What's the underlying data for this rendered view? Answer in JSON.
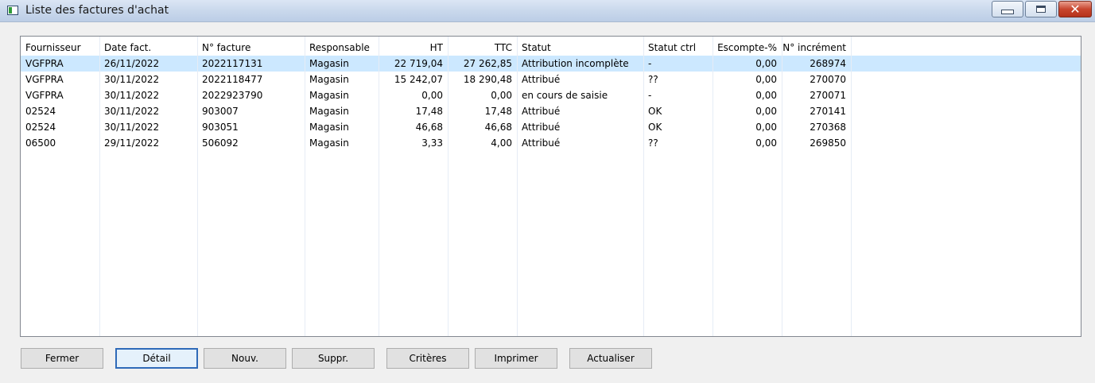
{
  "window": {
    "title": "Liste des factures d'achat",
    "close_glyph": "✕",
    "icons": [
      "app-icon",
      "minimize-icon",
      "maximize-icon",
      "close-icon"
    ]
  },
  "table": {
    "columns": [
      "Fournisseur",
      "Date fact.",
      "N° facture",
      "Responsable",
      "HT",
      "TTC",
      "Statut",
      "Statut ctrl",
      "Escompte-%",
      "N° incrément"
    ],
    "rows": [
      [
        "VGFPRA",
        "26/11/2022",
        "2022117131",
        "Magasin",
        "22 719,04",
        "27 262,85",
        "Attribution incomplète",
        "-",
        "0,00",
        "268974"
      ],
      [
        "VGFPRA",
        "30/11/2022",
        "2022118477",
        "Magasin",
        "15 242,07",
        "18 290,48",
        "Attribué",
        "??",
        "0,00",
        "270070"
      ],
      [
        "VGFPRA",
        "30/11/2022",
        "2022923790",
        "Magasin",
        "0,00",
        "0,00",
        "en cours de saisie",
        "-",
        "0,00",
        "270071"
      ],
      [
        "02524",
        "30/11/2022",
        "903007",
        "Magasin",
        "17,48",
        "17,48",
        "Attribué",
        "OK",
        "0,00",
        "270141"
      ],
      [
        "02524",
        "30/11/2022",
        "903051",
        "Magasin",
        "46,68",
        "46,68",
        "Attribué",
        "OK",
        "0,00",
        "270368"
      ],
      [
        "06500",
        "29/11/2022",
        "506092",
        "Magasin",
        "3,33",
        "4,00",
        "Attribué",
        "??",
        "0,00",
        "269850"
      ]
    ],
    "selected_row": 0,
    "selection_color": "#cce8ff"
  },
  "buttons": {
    "close": "Fermer",
    "detail": "Détail",
    "new": "Nouv.",
    "delete": "Suppr.",
    "criteria": "Critères",
    "print": "Imprimer",
    "refresh": "Actualiser"
  }
}
